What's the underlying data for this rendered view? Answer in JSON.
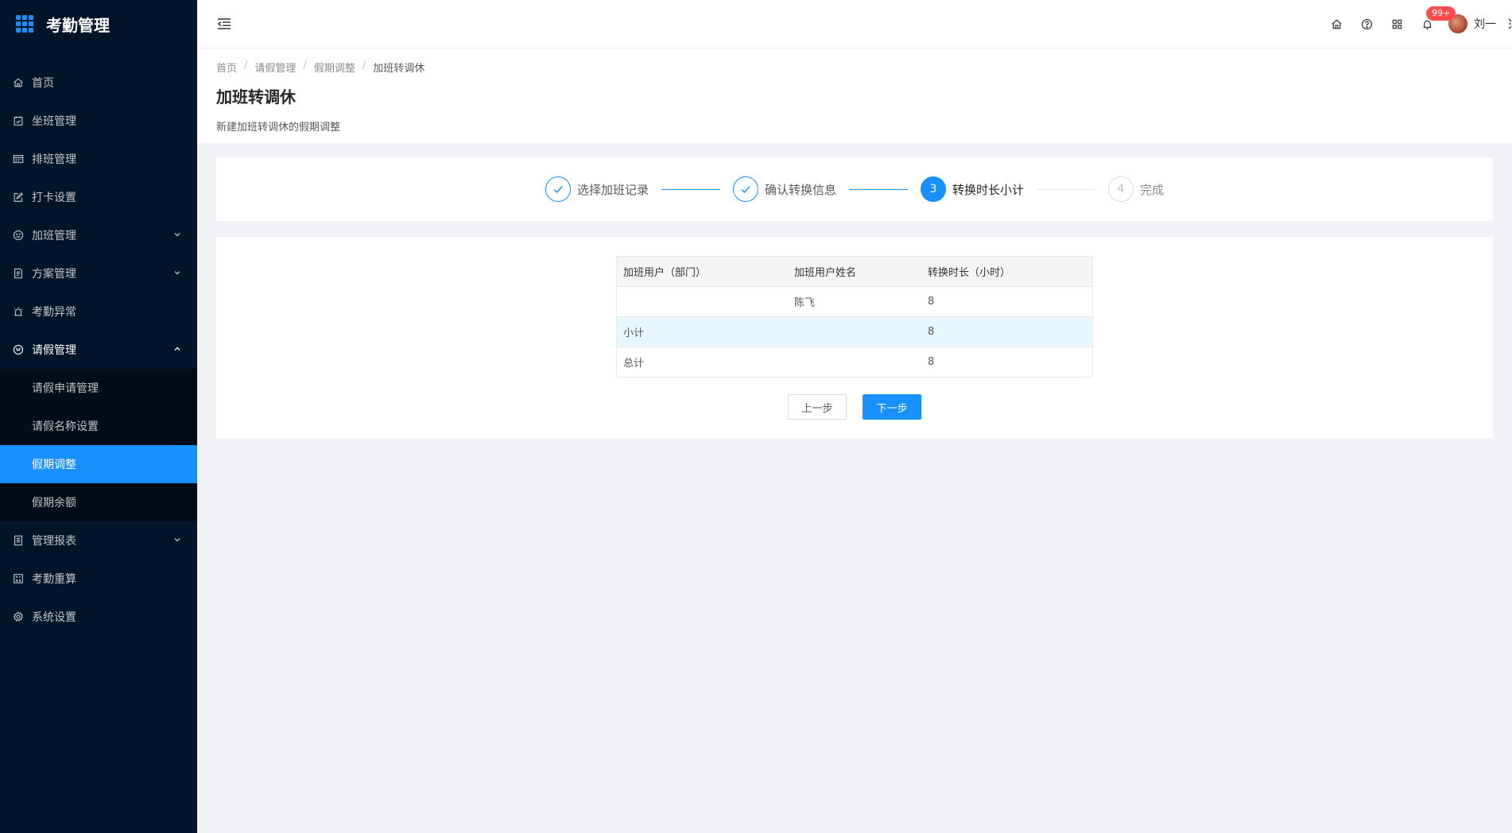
{
  "app": {
    "title": "考勤管理"
  },
  "sidebar": {
    "items": [
      {
        "label": "首页",
        "icon": "home-icon"
      },
      {
        "label": "坐班管理",
        "icon": "calendar-check-icon"
      },
      {
        "label": "排班管理",
        "icon": "schedule-icon"
      },
      {
        "label": "打卡设置",
        "icon": "edit-icon"
      },
      {
        "label": "加班管理",
        "icon": "smile-icon",
        "expandable": true
      },
      {
        "label": "方案管理",
        "icon": "file-icon",
        "expandable": true
      },
      {
        "label": "考勤异常",
        "icon": "alarm-icon"
      },
      {
        "label": "请假管理",
        "icon": "clock-icon",
        "expandable": true,
        "open": true
      }
    ],
    "submenu": [
      {
        "label": "请假申请管理"
      },
      {
        "label": "请假名称设置"
      },
      {
        "label": "假期调整",
        "active": true
      },
      {
        "label": "假期余额"
      }
    ],
    "items_after": [
      {
        "label": "管理报表",
        "icon": "report-icon",
        "expandable": true
      },
      {
        "label": "考勤重算",
        "icon": "calculator-icon"
      },
      {
        "label": "系统设置",
        "icon": "gear-icon"
      }
    ]
  },
  "header": {
    "badge": "99+",
    "username": "刘一"
  },
  "breadcrumb": [
    "首页",
    "请假管理",
    "假期调整",
    "加班转调休"
  ],
  "page": {
    "title": "加班转调休",
    "description": "新建加班转调休的假期调整"
  },
  "steps": [
    {
      "index": "1",
      "title": "选择加班记录",
      "status": "finish"
    },
    {
      "index": "2",
      "title": "确认转换信息",
      "status": "finish"
    },
    {
      "index": "3",
      "title": "转换时长小计",
      "status": "process"
    },
    {
      "index": "4",
      "title": "完成",
      "status": "wait"
    }
  ],
  "table": {
    "columns": [
      "加班用户（部门）",
      "加班用户姓名",
      "转换时长（小时）"
    ],
    "rows": [
      [
        "",
        "陈飞",
        "8"
      ],
      [
        "小计",
        "",
        "8"
      ],
      [
        "总计",
        "",
        "8"
      ]
    ]
  },
  "buttons": {
    "prev": "上一步",
    "next": "下一步"
  },
  "colors": {
    "sidebar_bg": "#001529",
    "primary": "#1890ff",
    "badge": "#ff4d4f"
  }
}
